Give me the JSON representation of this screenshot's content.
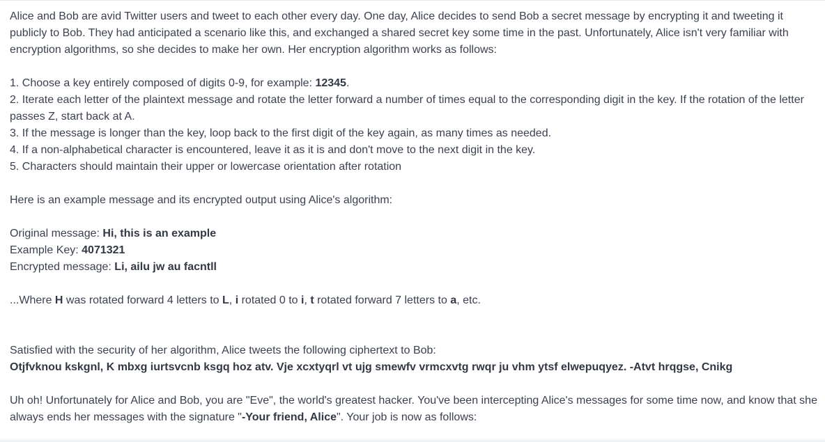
{
  "intro": "Alice and Bob are avid Twitter users and tweet to each other every day. One day, Alice decides to send Bob a secret message by encrypting it and tweeting it publicly to Bob. They had anticipated a scenario like this, and exchanged a shared secret key some time in the past. Unfortunately, Alice isn't very familiar with encryption algorithms, so she decides to make her own. Her encryption algorithm works as follows:",
  "steps": {
    "s1_pre": "1. Choose a key entirely composed of digits 0-9, for example: ",
    "s1_key": "12345",
    "s1_post": ".",
    "s2": "2. Iterate each letter of the plaintext message and rotate the letter forward a number of times equal to the corresponding digit in the key. If the rotation of the letter passes Z, start back at A.",
    "s3": "3. If the message is longer than the key, loop back to the first digit of the key again, as many times as needed.",
    "s4": "4. If a non-alphabetical character is encountered, leave it as it is and don't move to the next digit in the key.",
    "s5": "5. Characters should maintain their upper or lowercase orientation after rotation"
  },
  "example_intro": "Here is an example message and its encrypted output using Alice's algorithm:",
  "example": {
    "orig_label": "Original message: ",
    "orig_value": "Hi, this is an example",
    "key_label": "Example Key: ",
    "key_value": "4071321",
    "enc_label": "Encrypted message: ",
    "enc_value": "Li, ailu jw au facntll"
  },
  "explain": {
    "p1": "...Where ",
    "b1": "H",
    "p2": " was rotated forward 4 letters to ",
    "b2": "L",
    "p3": ", ",
    "b3": "i",
    "p4": " rotated 0 to ",
    "b4": "i",
    "p5": ", ",
    "b5": "t",
    "p6": " rotated forward 7 letters to ",
    "b6": "a",
    "p7": ", etc."
  },
  "satisfied": "Satisfied with the security of her algorithm, Alice tweets the following ciphertext to Bob:",
  "ciphertext": "Otjfvknou kskgnl, K mbxg iurtsvcnb ksgq hoz atv. Vje xcxtyqrl vt ujg smewfv vrmcxvtg rwqr ju vhm ytsf elwepuqyez. -Atvt hrqgse, Cnikg",
  "eve": {
    "pre": "Uh oh! Unfortunately for Alice and Bob, you are \"Eve\", the world's greatest hacker. You've been intercepting Alice's messages for some time now, and know that she always ends her messages with the signature \"",
    "sig": "-Your friend, Alice",
    "post": "\". Your job is now as follows:"
  }
}
